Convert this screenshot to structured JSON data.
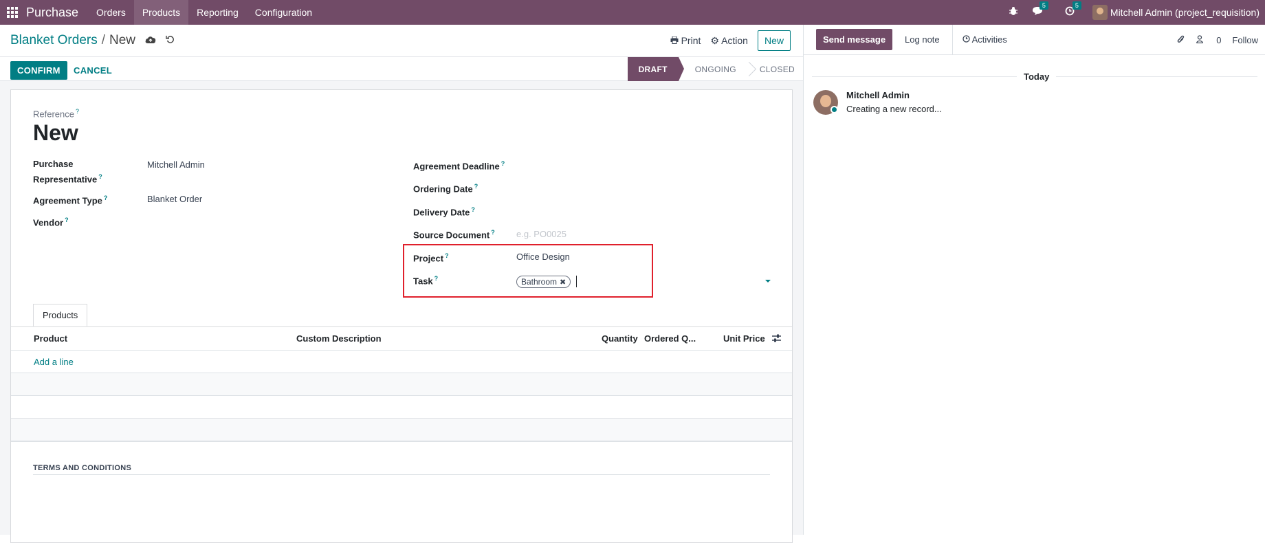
{
  "app": {
    "name": "Purchase",
    "menu": [
      "Orders",
      "Products",
      "Reporting",
      "Configuration"
    ],
    "active_menu": "Products",
    "messages_count": "5",
    "activities_count": "5",
    "user": "Mitchell Admin (project_requisition)"
  },
  "breadcrumb": {
    "parent": "Blanket Orders",
    "current": "New"
  },
  "actions": {
    "print": "Print",
    "action": "Action",
    "new": "New"
  },
  "statusbar": {
    "confirm": "CONFIRM",
    "cancel": "CANCEL",
    "stages": [
      "DRAFT",
      "ONGOING",
      "CLOSED"
    ],
    "current_stage": "DRAFT"
  },
  "form": {
    "reference_label": "Reference",
    "reference_value": "New",
    "purchase_rep_label_1": "Purchase",
    "purchase_rep_label_2": "Representative",
    "purchase_rep_value": "Mitchell Admin",
    "agreement_type_label": "Agreement Type",
    "agreement_type_value": "Blanket Order",
    "vendor_label": "Vendor",
    "agreement_deadline_label": "Agreement Deadline",
    "ordering_date_label": "Ordering Date",
    "delivery_date_label": "Delivery Date",
    "source_document_label": "Source Document",
    "source_document_placeholder": "e.g. PO0025",
    "project_label": "Project",
    "project_value": "Office Design",
    "task_label": "Task",
    "task_tag": "Bathroom",
    "help_mark": "?"
  },
  "tabs": [
    "Products"
  ],
  "table": {
    "columns": [
      "Product",
      "Custom Description",
      "Quantity",
      "Ordered Q...",
      "Unit Price"
    ],
    "add_line": "Add a line"
  },
  "terms_label": "TERMS AND CONDITIONS",
  "chatter": {
    "send_message": "Send message",
    "log_note": "Log note",
    "activities": "Activities",
    "followers_count": "0",
    "follow": "Follow",
    "date_separator": "Today",
    "message_author": "Mitchell Admin",
    "message_body": "Creating a new record..."
  },
  "colors": {
    "brand": "#714b67",
    "accent": "#017e84",
    "highlight": "#e0202c"
  }
}
